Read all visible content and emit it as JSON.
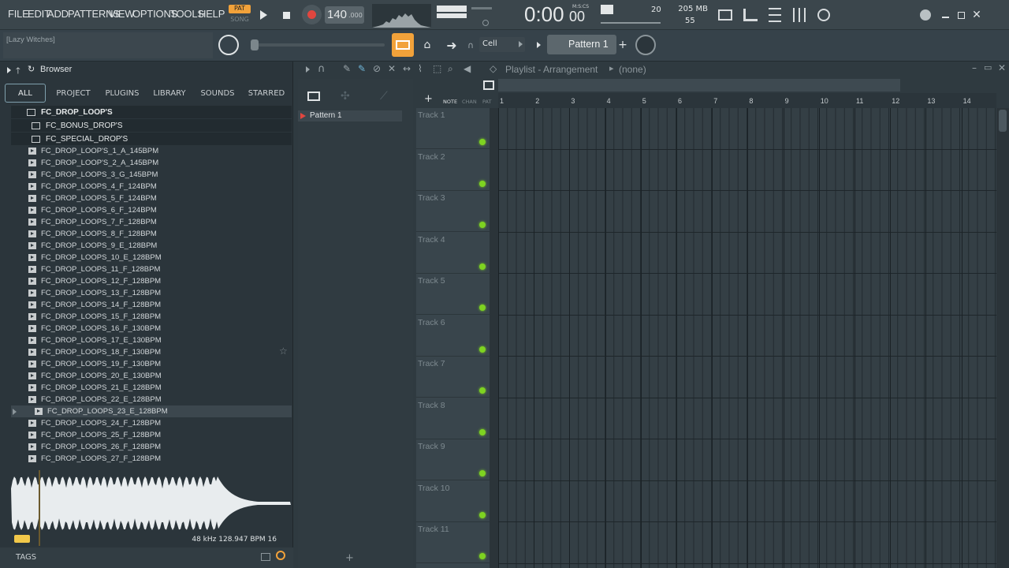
{
  "menu": [
    "FILE",
    "EDIT",
    "ADD",
    "PATTERNS",
    "VIEW",
    "OPTIONS",
    "TOOLS",
    "HELP"
  ],
  "transport": {
    "pat": "PAT",
    "song": "SONG",
    "tempo": "140",
    "tempo_dec": ".000",
    "time": "0:00",
    "time_sub": "00",
    "time_unit": "M:S:CS"
  },
  "stats": {
    "cpu_num": "20",
    "memory": "205 MB",
    "poly": "55"
  },
  "hint_text": "[Lazy Witches]",
  "snap": {
    "label": "Cell"
  },
  "pattern_selector": {
    "label": "Pattern 1"
  },
  "browser": {
    "title": "Browser",
    "tabs": [
      "ALL",
      "PROJECT",
      "PLUGINS",
      "LIBRARY",
      "SOUNDS",
      "STARRED"
    ],
    "folders": [
      "FC_DROP_LOOP'S",
      "FC_BONUS_DROP'S",
      "FC_SPECIAL_DROP'S"
    ],
    "files": [
      "FC_DROP_LOOP'S_1_A_145BPM",
      "FC_DROP_LOOP'S_2_A_145BPM",
      "FC_DROP_LOOPS_3_G_145BPM",
      "FC_DROP_LOOPS_4_F_124BPM",
      "FC_DROP_LOOPS_5_F_124BPM",
      "FC_DROP_LOOPS_6_F_124BPM",
      "FC_DROP_LOOPS_7_F_128BPM",
      "FC_DROP_LOOPS_8_F_128BPM",
      "FC_DROP_LOOPS_9_E_128BPM",
      "FC_DROP_LOOPS_10_E_128BPM",
      "FC_DROP_LOOPS_11_F_128BPM",
      "FC_DROP_LOOPS_12_F_128BPM",
      "FC_DROP_LOOPS_13_F_128BPM",
      "FC_DROP_LOOPS_14_F_128BPM",
      "FC_DROP_LOOPS_15_F_128BPM",
      "FC_DROP_LOOPS_16_F_130BPM",
      "FC_DROP_LOOPS_17_E_130BPM",
      "FC_DROP_LOOPS_18_F_130BPM",
      "FC_DROP_LOOPS_19_F_130BPM",
      "FC_DROP_LOOPS_20_E_130BPM",
      "FC_DROP_LOOPS_21_E_128BPM",
      "FC_DROP_LOOPS_22_E_128BPM",
      "FC_DROP_LOOPS_23_E_128BPM",
      "FC_DROP_LOOPS_24_F_128BPM",
      "FC_DROP_LOOPS_25_F_128BPM",
      "FC_DROP_LOOPS_26_F_128BPM",
      "FC_DROP_LOOPS_27_F_128BPM"
    ],
    "selected_index": 22,
    "waveform_info": "48 kHz 128.947 BPM 16",
    "tags_label": "TAGS"
  },
  "patterns": {
    "items": [
      "Pattern 1"
    ]
  },
  "playlist": {
    "title": "Playlist - Arrangement",
    "clip": "(none)",
    "hdr": {
      "note": "NOTE",
      "chan": "CHAN",
      "pat": "PAT"
    },
    "ruler": [
      "1",
      "2",
      "3",
      "4",
      "5",
      "6",
      "7",
      "8",
      "9",
      "10",
      "11",
      "12",
      "13",
      "14"
    ],
    "tracks": [
      "Track 1",
      "Track 2",
      "Track 3",
      "Track 4",
      "Track 5",
      "Track 6",
      "Track 7",
      "Track 8",
      "Track 9",
      "Track 10",
      "Track 11"
    ]
  },
  "colors": {
    "accent": "#f2a23a",
    "green": "#7ed321",
    "bg": "#2f3a40"
  }
}
